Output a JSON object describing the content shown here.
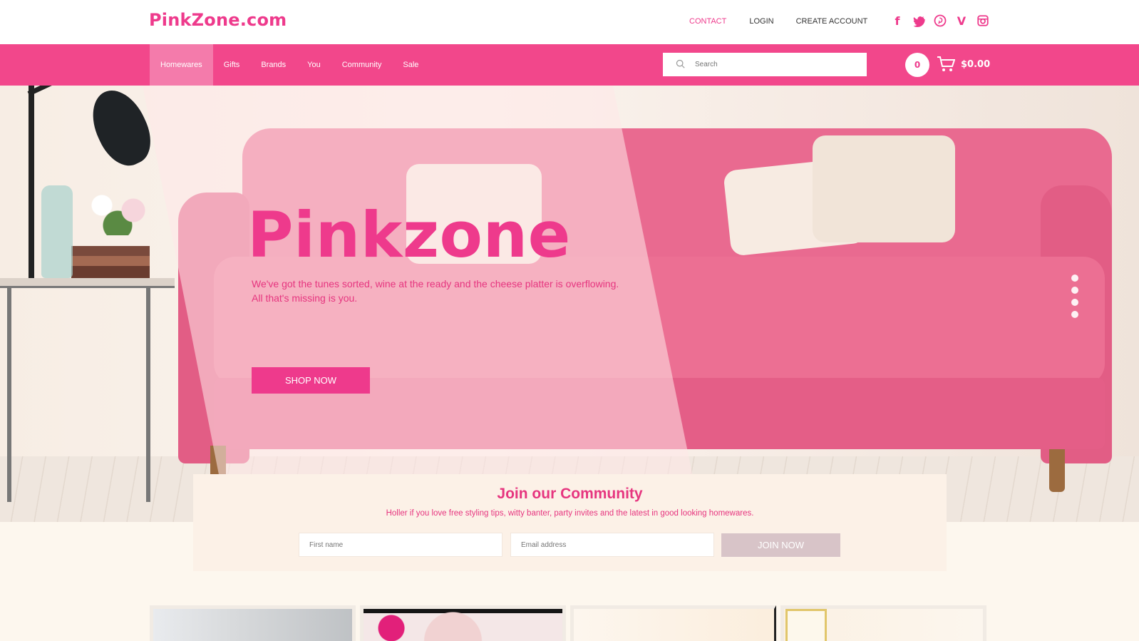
{
  "brand": {
    "logo": "PinkZone.com",
    "accent": "#ee3a8c",
    "nav_bg": "#f2478b"
  },
  "toplinks": {
    "contact": "CONTACT",
    "login": "LOGIN",
    "create_account": "CREATE ACCOUNT"
  },
  "social": {
    "facebook": "f",
    "vimeo": "V"
  },
  "nav": {
    "items": [
      {
        "label": "Homewares",
        "active": true
      },
      {
        "label": "Gifts"
      },
      {
        "label": "Brands"
      },
      {
        "label": "You"
      },
      {
        "label": "Community"
      },
      {
        "label": "Sale"
      }
    ]
  },
  "search": {
    "placeholder": "Search"
  },
  "cart": {
    "count": "0",
    "total": "$0.00"
  },
  "hero": {
    "title": "Pinkzone",
    "subtitle": "We've got the tunes sorted, wine at the ready and the cheese platter is overflowing. All that's missing is you.",
    "cta": "SHOP NOW",
    "slides": 4
  },
  "community": {
    "title": "Join our Community",
    "subtitle": "Holler if you love free styling tips, witty banter, party invites and the latest in good looking homewares.",
    "first_name_placeholder": "First name",
    "email_placeholder": "Email address",
    "join_label": "JOIN NOW"
  }
}
